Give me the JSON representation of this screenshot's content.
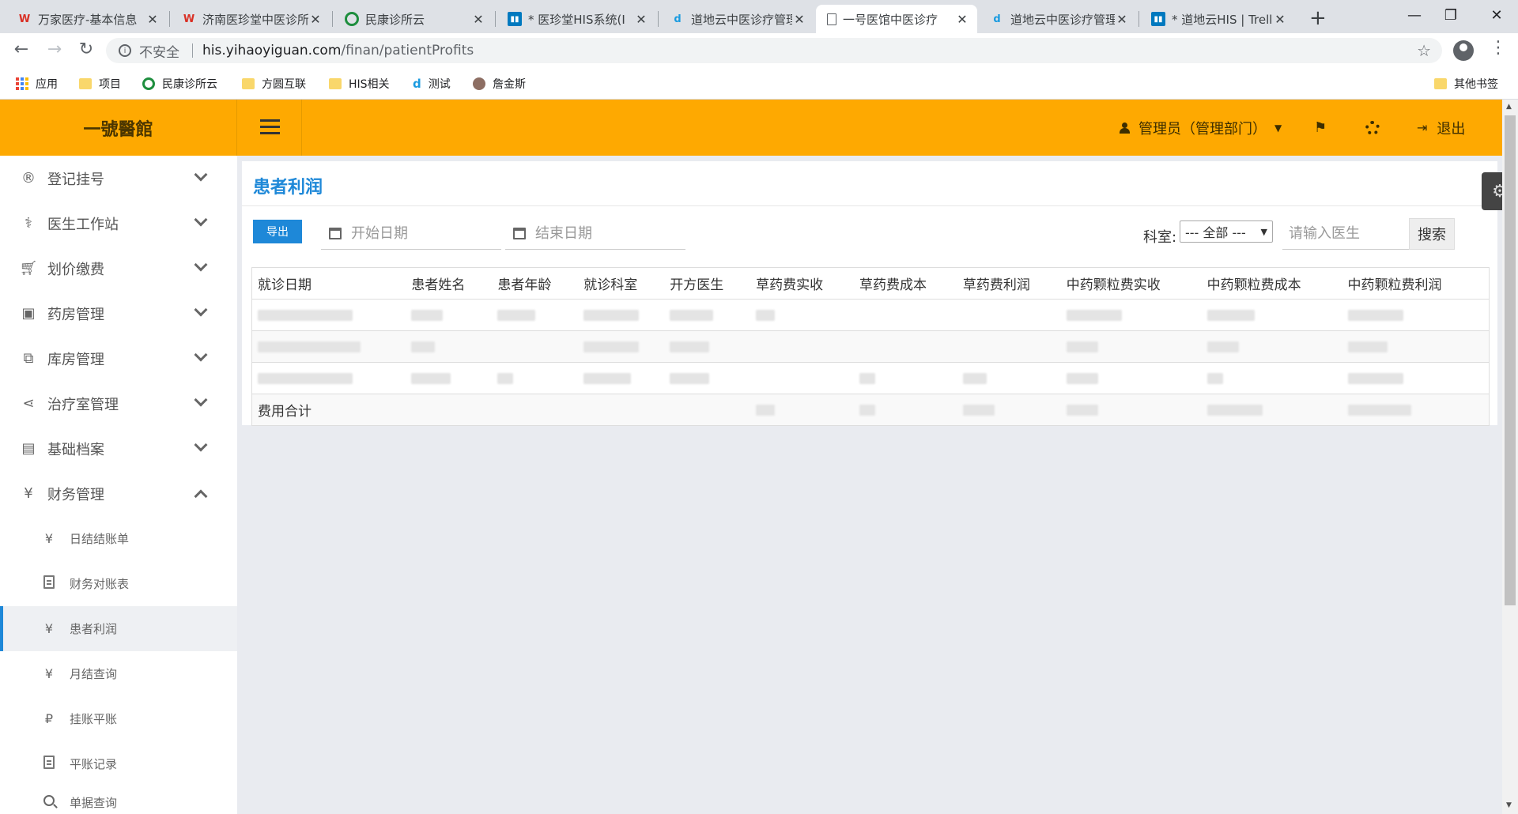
{
  "browser": {
    "tabs": [
      {
        "title": "万家医疗-基本信息",
        "icon": "wps-w-icon"
      },
      {
        "title": "济南医珍堂中医诊所",
        "icon": "wps-w-icon"
      },
      {
        "title": "民康诊所云",
        "icon": "green-circle-icon"
      },
      {
        "title": "* 医珍堂HIS系统(I",
        "icon": "trello-icon"
      },
      {
        "title": "道地云中医诊疗管理",
        "icon": "blue-d-icon"
      },
      {
        "title": "一号医馆中医诊疗",
        "icon": "page-icon",
        "active": true
      },
      {
        "title": "道地云中医诊疗管理",
        "icon": "blue-d-icon"
      },
      {
        "title": "* 道地云HIS | Trello",
        "icon": "trello-icon"
      }
    ],
    "address": {
      "insecure_label": "不安全",
      "host": "his.yihaoyiguan.com",
      "path": "/finan/patientProfits"
    },
    "bookmarks": [
      {
        "label": "应用",
        "icon": "apps-grid-icon"
      },
      {
        "label": "项目",
        "icon": "folder-icon"
      },
      {
        "label": "民康诊所云",
        "icon": "green-circle-icon"
      },
      {
        "label": "方圆互联",
        "icon": "folder-icon"
      },
      {
        "label": "HIS相关",
        "icon": "folder-icon"
      },
      {
        "label": "测试",
        "icon": "blue-d-icon"
      },
      {
        "label": "詹金斯",
        "icon": "jenkins-icon"
      }
    ],
    "other_bookmarks": "其他书签"
  },
  "app": {
    "brand": "一號醫館",
    "user_label": "管理员（管理部门）",
    "logout_label": "退出",
    "accent": "#fea901",
    "link_color": "#1e88d8"
  },
  "sidebar": {
    "items": [
      {
        "label": "登记挂号",
        "icon": "registered-icon"
      },
      {
        "label": "医生工作站",
        "icon": "user-md-icon"
      },
      {
        "label": "划价缴费",
        "icon": "cart-icon"
      },
      {
        "label": "药房管理",
        "icon": "hospital-icon"
      },
      {
        "label": "库房管理",
        "icon": "cubes-icon"
      },
      {
        "label": "治疗室管理",
        "icon": "share-icon"
      },
      {
        "label": "基础档案",
        "icon": "book-icon"
      },
      {
        "label": "财务管理",
        "icon": "yen-icon"
      }
    ],
    "finance_sub": [
      {
        "label": "日结结账单",
        "icon": "yen-icon"
      },
      {
        "label": "财务对账表",
        "icon": "file-text-icon"
      },
      {
        "label": "患者利润",
        "icon": "yen-icon"
      },
      {
        "label": "月结查询",
        "icon": "yen-icon"
      },
      {
        "label": "挂账平账",
        "icon": "ruble-icon"
      },
      {
        "label": "平账记录",
        "icon": "file-p-icon"
      },
      {
        "label": "单据查询",
        "icon": "search-icon"
      }
    ]
  },
  "main": {
    "title": "患者利润",
    "export_label": "导出",
    "start_date_placeholder": "开始日期",
    "end_date_placeholder": "结束日期",
    "dept_label": "科室:",
    "dept_value": "--- 全部 ---",
    "doctor_placeholder": "请输入医生",
    "search_label": "搜索",
    "columns": [
      "就诊日期",
      "患者姓名",
      "患者年龄",
      "就诊科室",
      "开方医生",
      "草药费实收",
      "草药费成本",
      "草药费利润",
      "中药颗粒费实收",
      "中药颗粒费成本",
      "中药颗粒费利润"
    ],
    "total_label": "费用合计"
  }
}
